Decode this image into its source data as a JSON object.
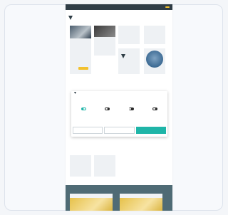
{
  "topbar": {
    "links": [
      "",
      "",
      ""
    ],
    "cta": ""
  },
  "nav": {
    "logo_text": "",
    "items": [
      "",
      "",
      "",
      "",
      "",
      "",
      ""
    ]
  },
  "tiles": [
    {
      "title": "",
      "text": ""
    },
    {
      "title": "",
      "text": ""
    },
    {
      "title": "",
      "text": ""
    },
    {
      "title": "",
      "text": ""
    },
    {
      "title": "",
      "text": ""
    },
    {
      "title": "",
      "text": ""
    }
  ],
  "cookie_modal": {
    "title": "",
    "text": "",
    "toggles": [
      {
        "label": "",
        "on": true
      },
      {
        "label": "",
        "on": false
      },
      {
        "label": "",
        "on": false
      },
      {
        "label": "",
        "on": false
      }
    ],
    "details_link": "",
    "buttons": [
      "",
      "",
      ""
    ]
  },
  "section": {
    "title": "",
    "cards": [
      {
        "title": "",
        "text": ""
      },
      {
        "title": "",
        "text": ""
      }
    ],
    "more_link": ""
  },
  "footer": {
    "title": "",
    "cards": [
      {
        "title": ""
      },
      {
        "title": ""
      }
    ]
  },
  "colors": {
    "dark": "#2f3d46",
    "accent_yellow": "#f2c12e",
    "accent_teal": "#1fb5a8",
    "footer_band": "#4f6b75"
  }
}
